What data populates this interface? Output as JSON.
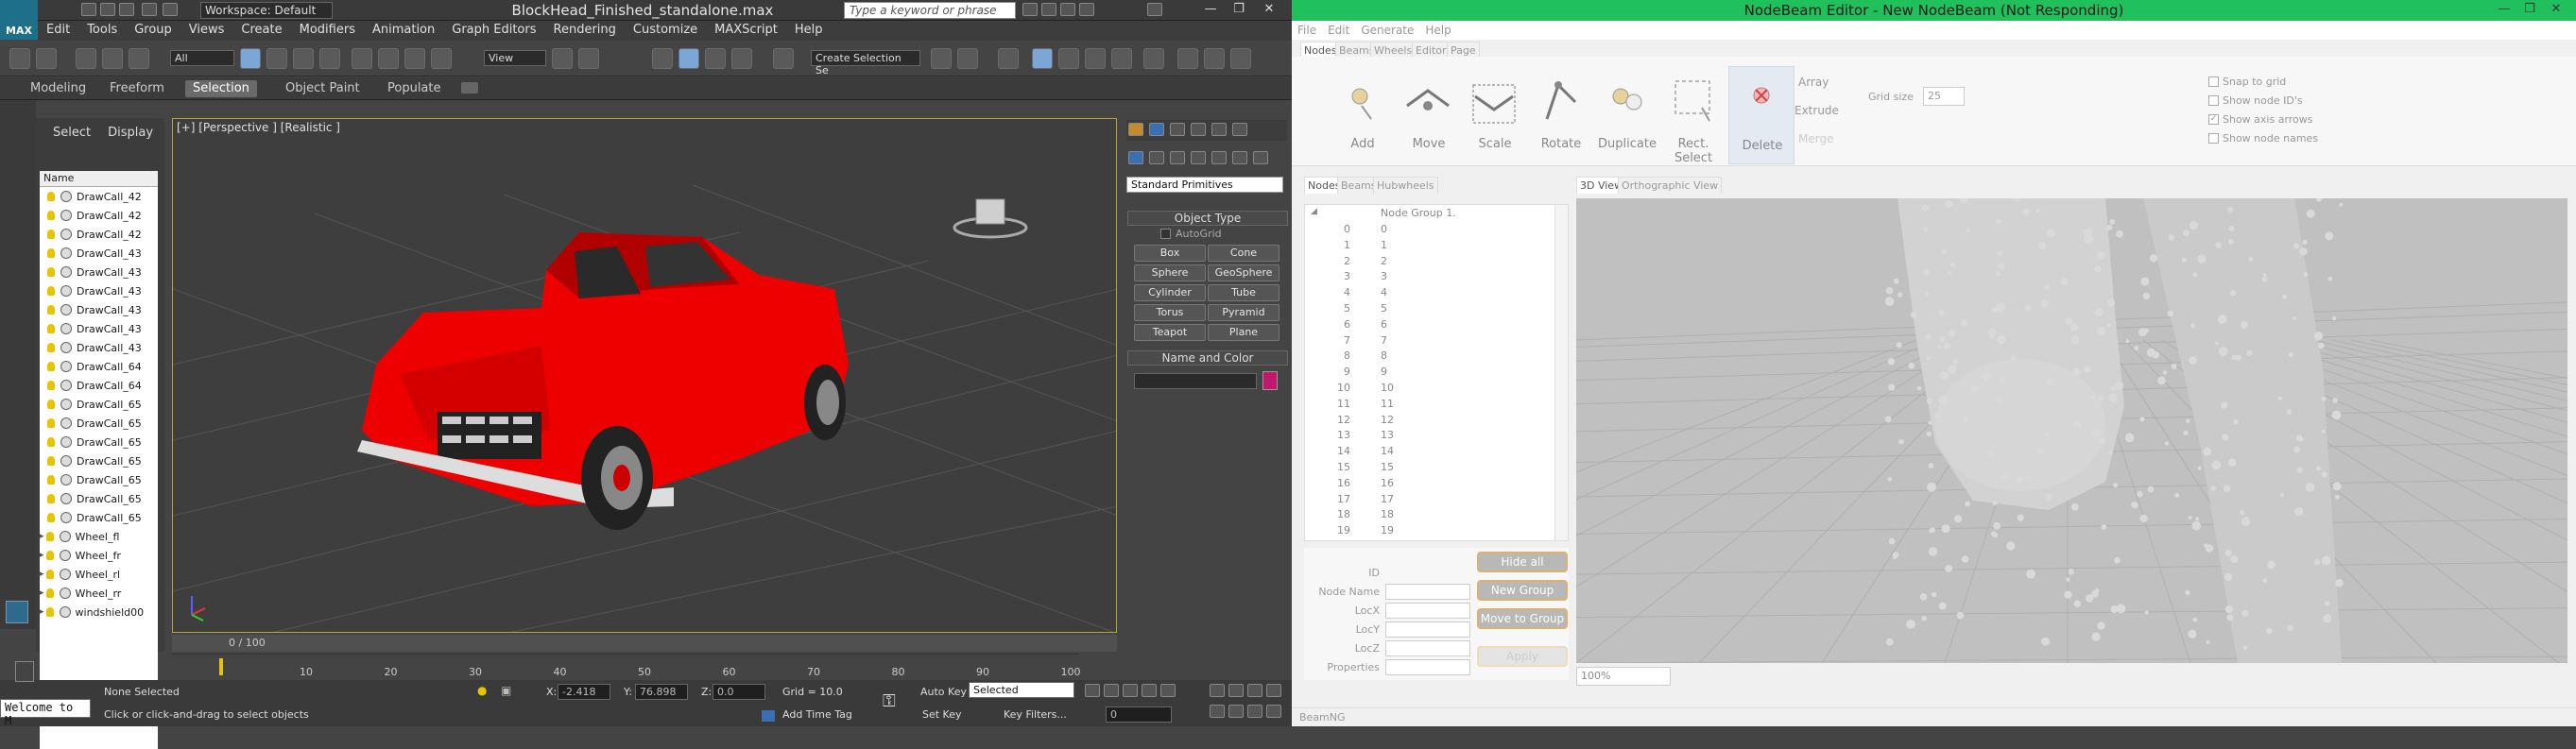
{
  "max": {
    "logo": "MAX",
    "workspace": "Workspace: Default",
    "title": "BlockHead_Finished_standalone.max",
    "search_placeholder": "Type a keyword or phrase",
    "menu": [
      "Edit",
      "Tools",
      "Group",
      "Views",
      "Create",
      "Modifiers",
      "Animation",
      "Graph Editors",
      "Rendering",
      "Customize",
      "MAXScript",
      "Help"
    ],
    "toolbar": {
      "filter": "All",
      "refcoord": "View",
      "selection_set": "Create Selection Se"
    },
    "ribbon_tabs": [
      "Modeling",
      "Freeform",
      "Selection",
      "Object Paint",
      "Populate"
    ],
    "ribbon_active": "Selection",
    "scene_explorer": {
      "tabs": [
        "Select",
        "Display"
      ],
      "column": "Name",
      "items": [
        "DrawCall_42",
        "DrawCall_42",
        "DrawCall_42",
        "DrawCall_43",
        "DrawCall_43",
        "DrawCall_43",
        "DrawCall_43",
        "DrawCall_43",
        "DrawCall_43",
        "DrawCall_64",
        "DrawCall_64",
        "DrawCall_65",
        "DrawCall_65",
        "DrawCall_65",
        "DrawCall_65",
        "DrawCall_65",
        "DrawCall_65",
        "DrawCall_65",
        "Wheel_fl",
        "Wheel_fr",
        "Wheel_rl",
        "Wheel_rr",
        "windshield00"
      ]
    },
    "viewport_label": "[+] [Perspective ] [Realistic ]",
    "timeline": "0 / 100",
    "ruler_ticks": [
      "10",
      "20",
      "30",
      "40",
      "50",
      "60",
      "70",
      "80",
      "90",
      "100"
    ],
    "command_panel": {
      "dropdown": "Standard Primitives",
      "object_type_title": "Object Type",
      "autogrid": "AutoGrid",
      "buttons": [
        "Box",
        "Cone",
        "Sphere",
        "GeoSphere",
        "Cylinder",
        "Tube",
        "Torus",
        "Pyramid",
        "Teapot",
        "Plane"
      ],
      "name_color_title": "Name and Color",
      "swatch_color": "#c0186a"
    },
    "status": {
      "listener": "Welcome to M",
      "selection": "None Selected",
      "prompt": "Click or click-and-drag to select objects",
      "x_label": "X:",
      "x": "-2.418",
      "y_label": "Y:",
      "y": "76.898",
      "z_label": "Z:",
      "z": "0.0",
      "grid": "Grid = 10.0",
      "add_time_tag": "Add Time Tag",
      "auto_key": "Auto Key",
      "set_key": "Set Key",
      "key_mode": "Selected",
      "key_filters": "Key Filters...",
      "frame": "0"
    }
  },
  "nb": {
    "title": "NodeBeam Editor - New NodeBeam (Not Responding)",
    "menu": [
      "File",
      "Edit",
      "Generate",
      "Help"
    ],
    "tabs_top": [
      "Nodes",
      "Beams",
      "Wheels",
      "Editor",
      "Page"
    ],
    "tools": [
      "Add",
      "Move",
      "Scale",
      "Rotate",
      "Duplicate",
      "Rect. Select",
      "Delete"
    ],
    "sub": [
      "Array",
      "Extrude",
      "Merge"
    ],
    "grid_size_label": "Grid size",
    "grid_size": "25",
    "checks": [
      {
        "label": "Snap to grid",
        "checked": false
      },
      {
        "label": "Show node ID's",
        "checked": false
      },
      {
        "label": "Show axis arrows",
        "checked": true
      },
      {
        "label": "Show node names",
        "checked": false
      }
    ],
    "list_tabs": [
      "Nodes",
      "Beams",
      "Hubwheels"
    ],
    "group": "Node Group 1.",
    "nodes": [
      "0",
      "1",
      "2",
      "3",
      "4",
      "5",
      "6",
      "7",
      "8",
      "9",
      "10",
      "11",
      "12",
      "13",
      "14",
      "15",
      "16",
      "17",
      "18",
      "19"
    ],
    "prop_labels": [
      "ID",
      "Node Name",
      "LocX",
      "LocY",
      "LocZ",
      "Properties"
    ],
    "prop_buttons": [
      "Hide all",
      "New Group",
      "Move to Group",
      "Apply"
    ],
    "view_tabs": [
      "3D View",
      "Orthographic View"
    ],
    "zoom": "100%",
    "status": "BeamNG"
  }
}
